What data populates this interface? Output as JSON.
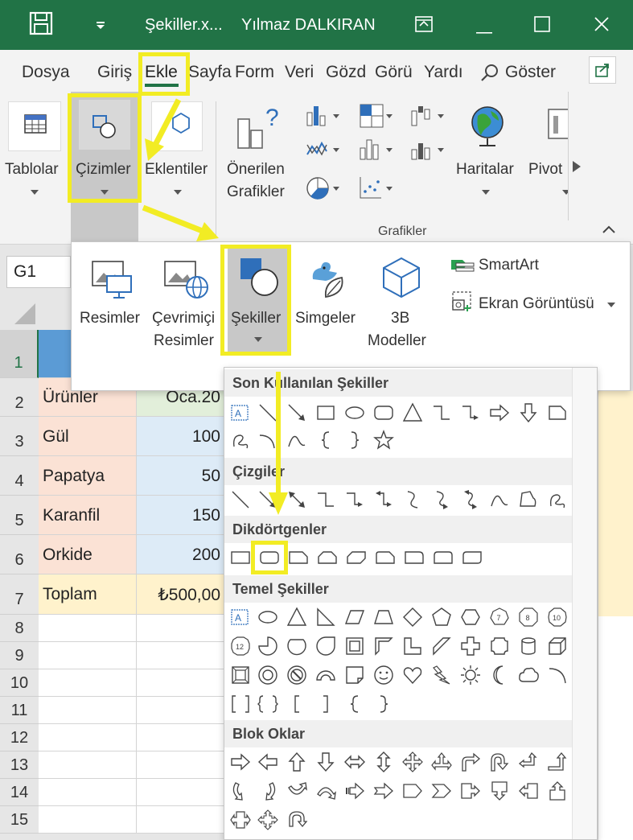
{
  "titlebar": {
    "doc_title": "Şekiller.x...",
    "user": "Yılmaz DALKIRAN",
    "accent": "#217346"
  },
  "tabs": [
    "Dosya",
    "Giriş",
    "Ekle",
    "Sayfa",
    "Form",
    "Veri",
    "Gözd",
    "Görü",
    "Yardı",
    "Göster"
  ],
  "ribbon": {
    "tablolar": "Tablolar",
    "cizimler": "Çizimler",
    "eklentiler": "Eklentiler",
    "onerilen_1": "Önerilen",
    "onerilen_2": "Grafikler",
    "haritalar": "Haritalar",
    "pivot": "Pivot",
    "group_grafikler": "Grafikler"
  },
  "namebox": "G1",
  "rows": [
    "1",
    "2",
    "3",
    "4",
    "5",
    "6",
    "7",
    "8",
    "9",
    "10",
    "11",
    "12",
    "13",
    "14",
    "15"
  ],
  "table": {
    "header": [
      "Ürünler",
      "Oca.20"
    ],
    "items": [
      {
        "name": "Gül",
        "value": "100"
      },
      {
        "name": "Papatya",
        "value": "50"
      },
      {
        "name": "Karanfil",
        "value": "150"
      },
      {
        "name": "Orkide",
        "value": "200"
      }
    ],
    "total_label": "Toplam",
    "total_value": "₺500,00"
  },
  "popup": {
    "resimler": "Resimler",
    "cevrimici_1": "Çevrimiçi",
    "cevrimici_2": "Resimler",
    "sekiller": "Şekiller",
    "simgeler": "Simgeler",
    "modeller_1": "3B",
    "modeller_2": "Modeller",
    "smartart": "SmartArt",
    "ekran": "Ekran Görüntüsü"
  },
  "gallery": {
    "recent": "Son Kullanılan Şekiller",
    "lines": "Çizgiler",
    "rectangles": "Dikdörtgenler",
    "basic": "Temel Şekiller",
    "block_arrows": "Blok Oklar"
  },
  "basic_labels": {
    "oct7": "7",
    "oct8": "8",
    "dec10": "10",
    "dodec12": "12"
  },
  "colors": {
    "highlight": "#f2ec24",
    "salmon": "#fbe2d5",
    "lightblue": "#ddebf7",
    "cream": "#fff2cc",
    "header_blue": "#5b9bd5"
  }
}
